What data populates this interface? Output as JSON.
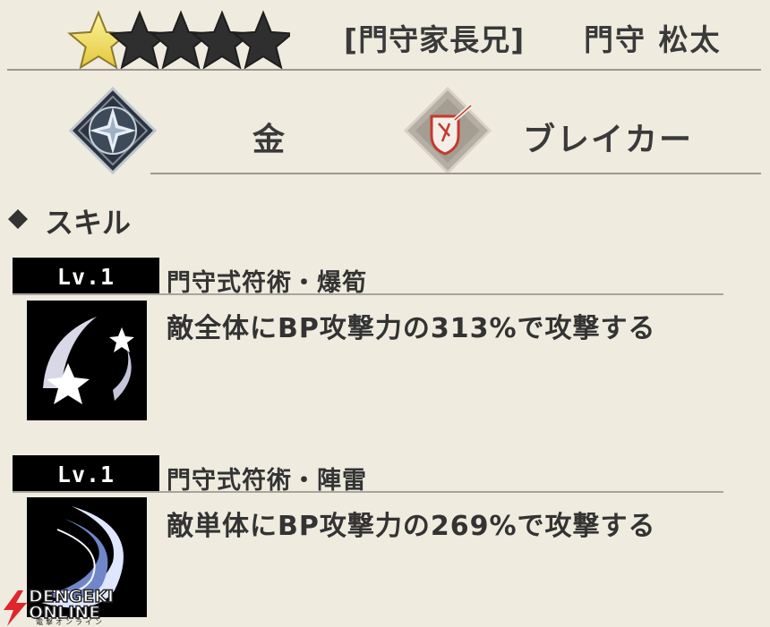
{
  "rarity": {
    "filled": 1,
    "total": 5,
    "filled_color": "#f2e064",
    "empty_color": "#2f2f2f"
  },
  "header": {
    "title_tag": "[門守家長兄]",
    "character_name": "門守 松太"
  },
  "attributes": {
    "element": {
      "icon": "ice-crystal-icon",
      "label": "金"
    },
    "role": {
      "icon": "shield-breaker-icon",
      "label": "ブレイカー"
    }
  },
  "skills_section": {
    "title": "スキル"
  },
  "skills": [
    {
      "level": "Lv.1",
      "name": "門守式符術・爆筍",
      "description": "敵全体にBP攻撃力の313%で攻撃する",
      "icon": "shooting-stars-icon"
    },
    {
      "level": "Lv.1",
      "name": "門守式符術・陣雷",
      "description": "敵単体にBP攻撃力の269%で攻撃する",
      "icon": "crescent-slash-icon"
    }
  ],
  "watermark": {
    "text": "DENGEKI ONLINE",
    "subtext": "電撃オンライン"
  },
  "colors": {
    "background": "#efebdf",
    "accent_red": "#e0262c"
  }
}
